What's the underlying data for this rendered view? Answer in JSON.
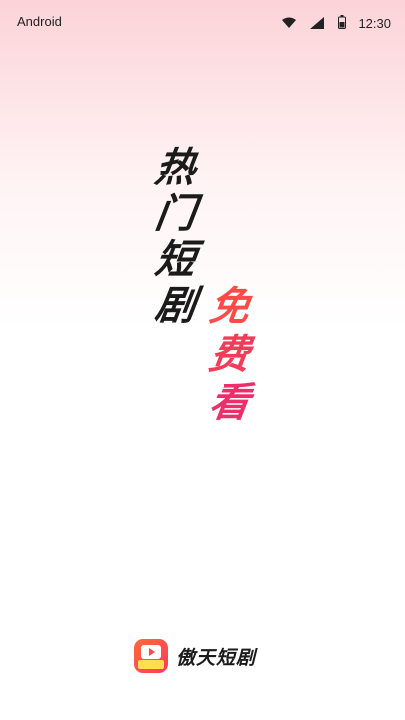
{
  "status_bar": {
    "carrier": "Android",
    "time": "12:30",
    "icons": [
      "wifi-icon",
      "cellular-signal-icon",
      "battery-icon"
    ]
  },
  "slogan": {
    "left_chars": [
      "热",
      "门",
      "短",
      "剧"
    ],
    "right_chars": [
      "免",
      "费",
      "看"
    ],
    "left_color": "#1b1b1b",
    "right_colors": [
      "#ff4a4a",
      "#f23d5a",
      "#ea2f6a"
    ]
  },
  "brand": {
    "name": "傲天短剧",
    "logo_colors": [
      "#ff6a3d",
      "#ff3b5c"
    ],
    "logo_tag_color": "#ffe04a"
  }
}
